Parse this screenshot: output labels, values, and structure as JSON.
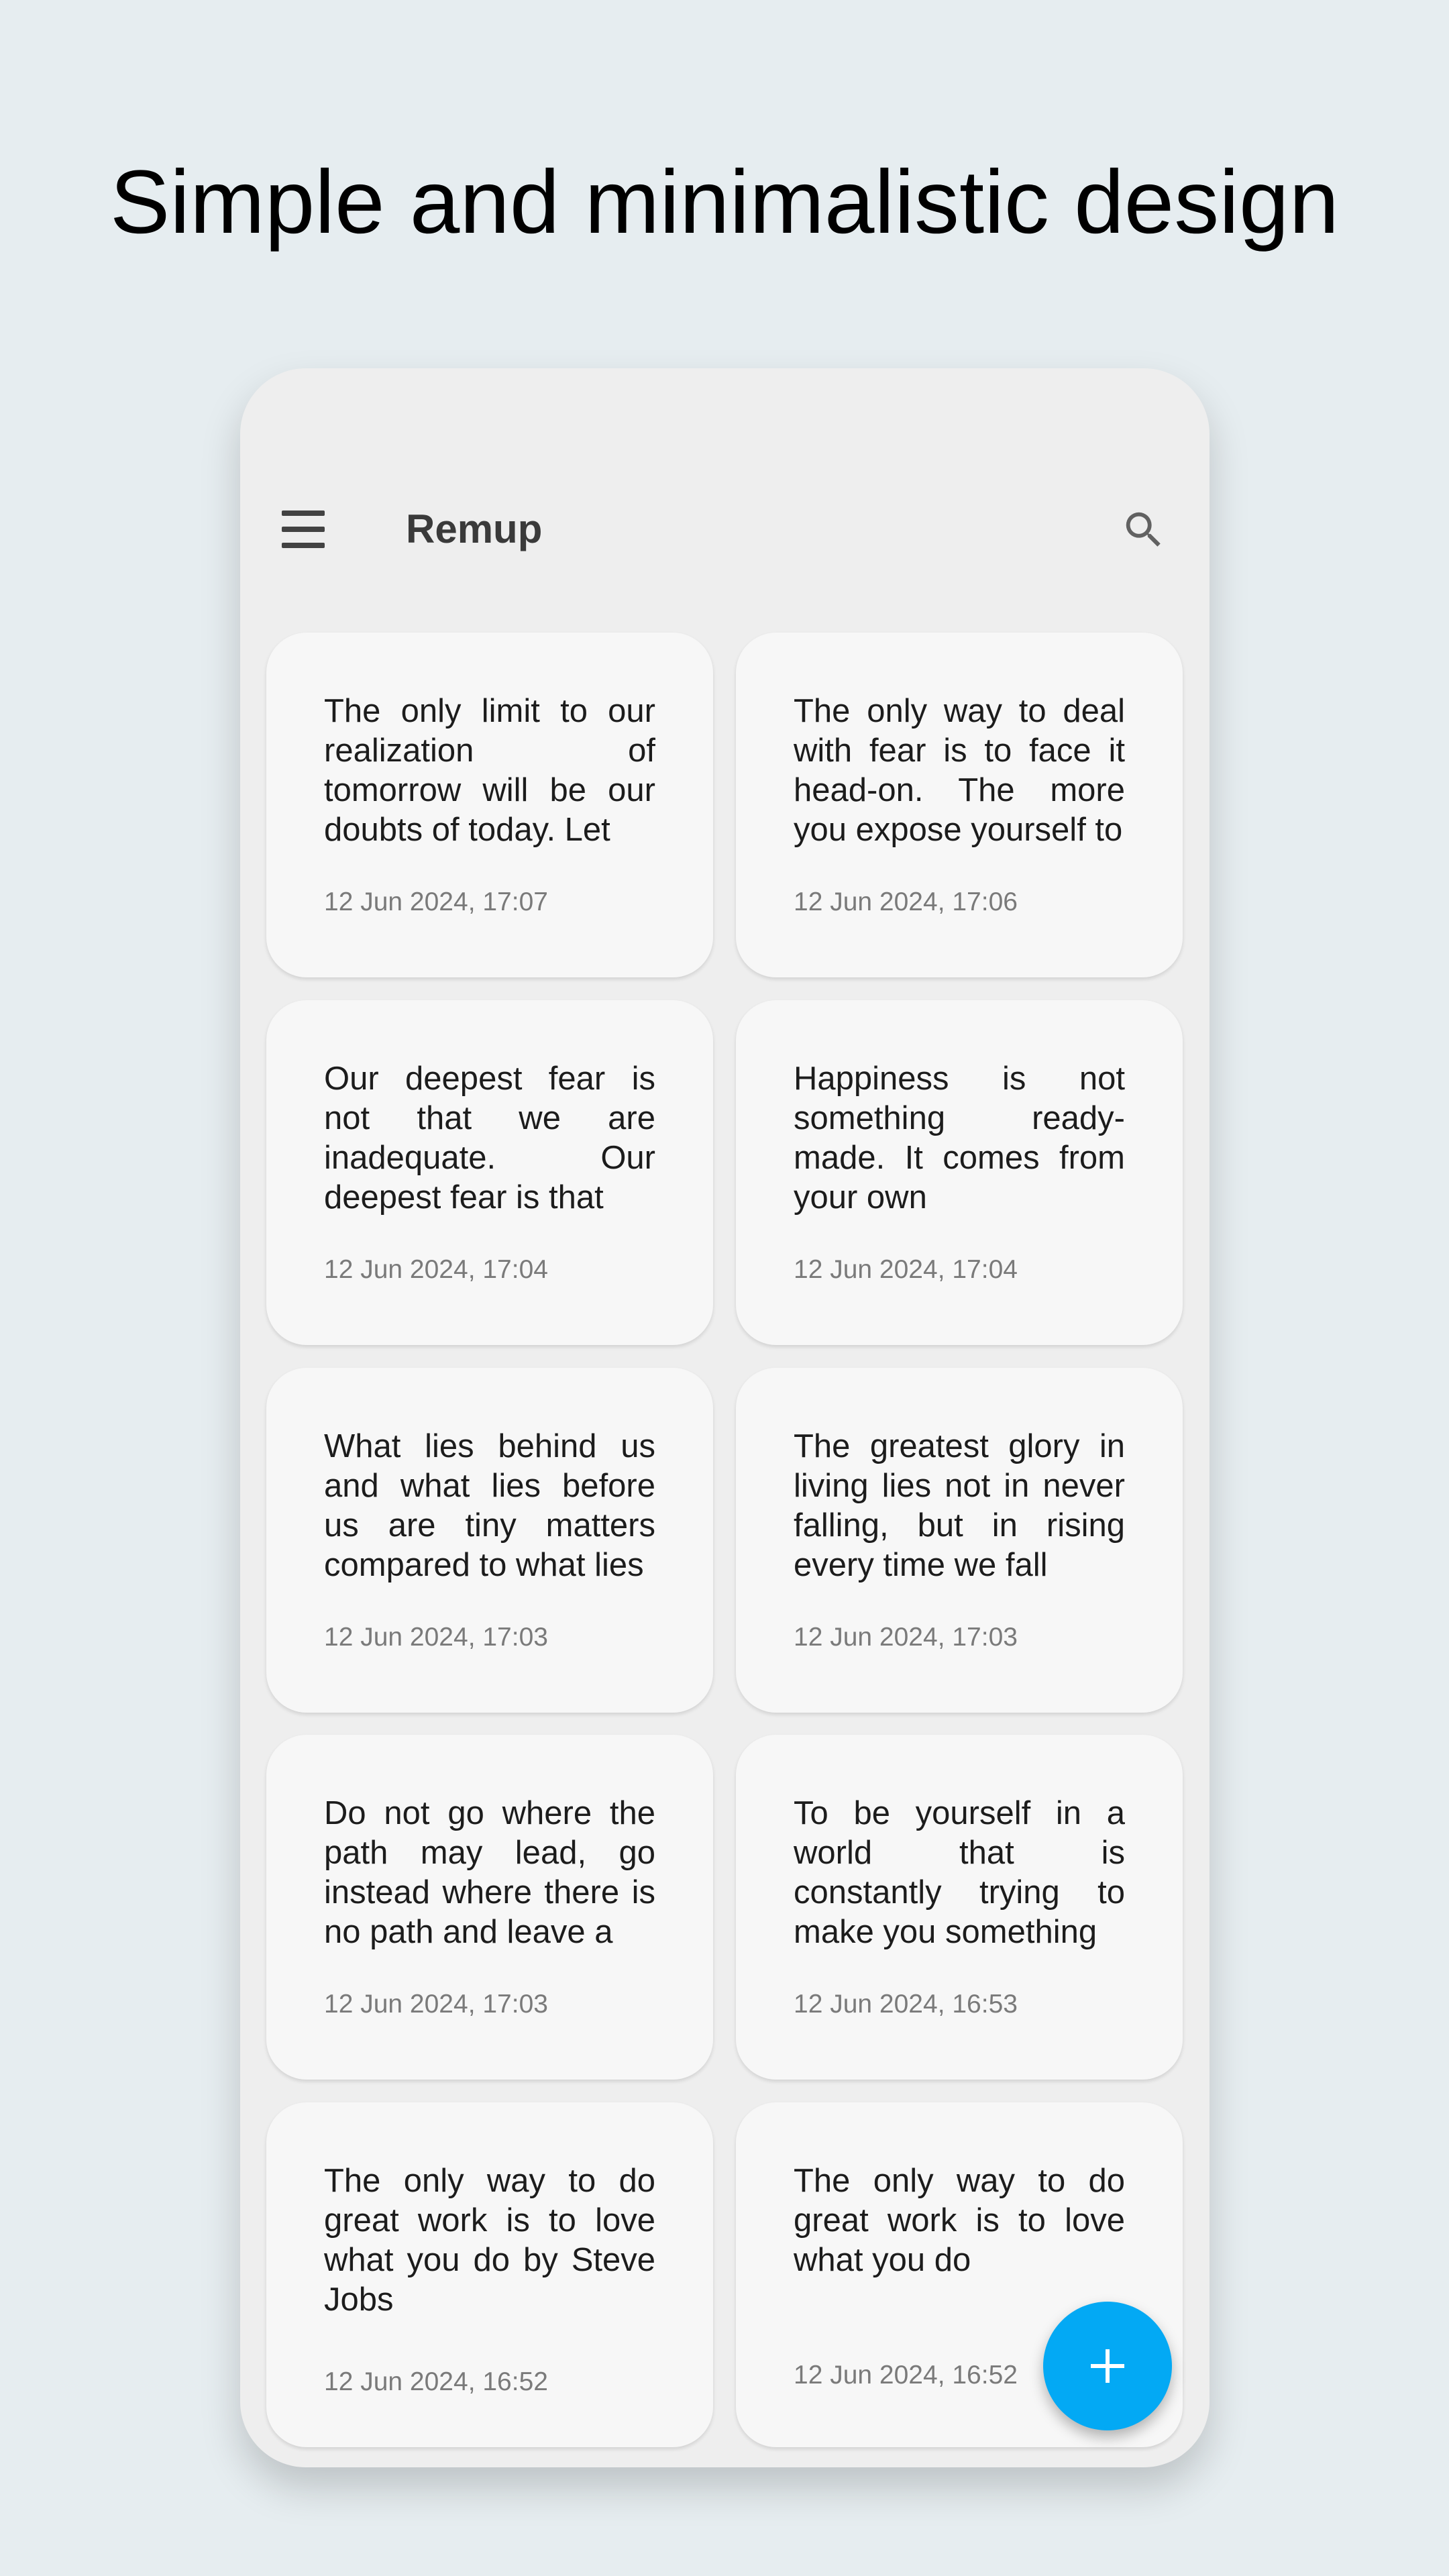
{
  "headline": "Simple and minimalistic design",
  "app": {
    "title": "Remup",
    "accent_color": "#03A9F4",
    "icons": {
      "menu": "menu-icon",
      "search": "search-icon",
      "add": "plus-icon"
    }
  },
  "notes": [
    {
      "text": "The only limit to our realization of tomorrow will be our doubts of today. Let",
      "date": "12 Jun 2024, 17:07"
    },
    {
      "text": "The only way to deal with fear is to face it head-on. The more you expose yourself to",
      "date": "12 Jun 2024, 17:06"
    },
    {
      "text": "Our deepest fear is not that we are inadequate. Our deepest fear is that",
      "date": "12 Jun 2024, 17:04"
    },
    {
      "text": "Happiness is not something ready-made. It comes from your own",
      "date": "12 Jun 2024, 17:04"
    },
    {
      "text": "What lies behind us and what lies before us are tiny matters compared to what lies",
      "date": "12 Jun 2024, 17:03"
    },
    {
      "text": "The greatest glory in living lies not in never falling, but in rising every time we fall",
      "date": "12 Jun 2024, 17:03"
    },
    {
      "text": "Do not go where the path may lead, go instead where there is no path and leave a",
      "date": "12 Jun 2024, 17:03"
    },
    {
      "text": "To be yourself in a world that is constantly trying to make you something",
      "date": "12 Jun 2024, 16:53"
    },
    {
      "text": "The only way to do great work is to love what you do by Steve Jobs",
      "date": "12 Jun 2024, 16:52"
    },
    {
      "text": "The only way to do great work is to love what you do",
      "date": "12 Jun 2024, 16:52"
    }
  ]
}
